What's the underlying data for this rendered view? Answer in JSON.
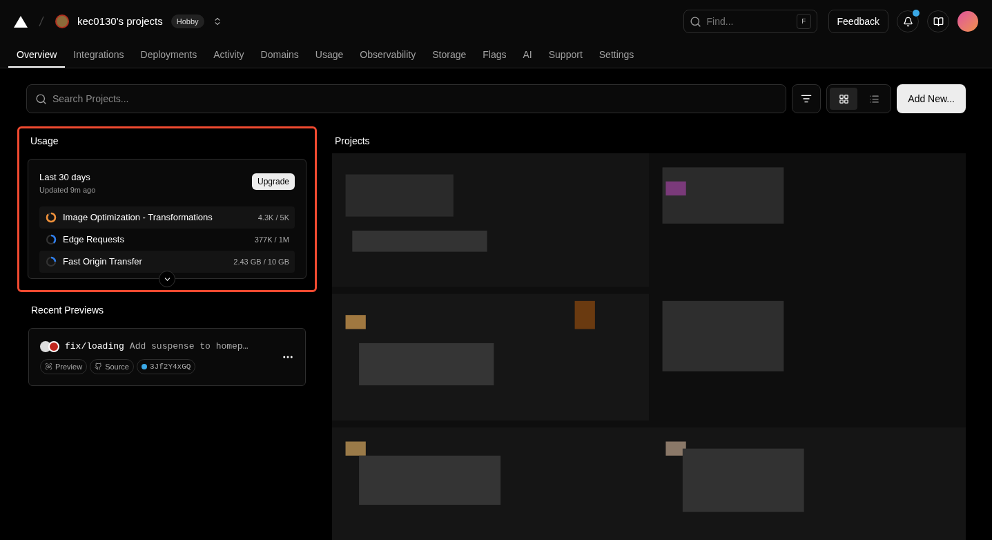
{
  "header": {
    "team": "kec0130's projects",
    "plan": "Hobby",
    "find": {
      "placeholder": "Find...",
      "shortcut": "F"
    },
    "feedback": "Feedback",
    "notification": true
  },
  "tabs": [
    {
      "label": "Overview",
      "selected": true
    },
    {
      "label": "Integrations",
      "selected": false
    },
    {
      "label": "Deployments",
      "selected": false
    },
    {
      "label": "Activity",
      "selected": false
    },
    {
      "label": "Domains",
      "selected": false
    },
    {
      "label": "Usage",
      "selected": false
    },
    {
      "label": "Observability",
      "selected": false
    },
    {
      "label": "Storage",
      "selected": false
    },
    {
      "label": "Flags",
      "selected": false
    },
    {
      "label": "AI",
      "selected": false
    },
    {
      "label": "Support",
      "selected": false
    },
    {
      "label": "Settings",
      "selected": false
    }
  ],
  "toolbar": {
    "search": {
      "placeholder": "Search Projects..."
    },
    "views": [
      {
        "kind": "grid",
        "selected": true
      },
      {
        "kind": "list",
        "selected": false
      }
    ],
    "add": "Add New..."
  },
  "usage": {
    "title": "Usage",
    "period": "Last 30 days",
    "updated": "Updated 9m ago",
    "upgrade": "Upgrade",
    "items": [
      {
        "name": "Image Optimization - Transformations",
        "reading": "4.3K / 5K",
        "color": "#f0913a"
      },
      {
        "name": "Edge Requests",
        "reading": "377K / 1M",
        "color": "#2f7ff0"
      },
      {
        "name": "Fast Origin Transfer",
        "reading": "2.43 GB / 10 GB",
        "color": "#2f7ff0"
      }
    ]
  },
  "previews": {
    "title": "Recent Previews",
    "items": [
      {
        "branch": "fix/loading",
        "message": "Add suspense to homep…",
        "tags": [
          {
            "kind": "preview",
            "label": "Preview"
          },
          {
            "kind": "source",
            "label": "Source"
          },
          {
            "kind": "commit",
            "label": "3Jf2Y4xGQ"
          }
        ]
      }
    ]
  },
  "projects": {
    "title": "Projects",
    "kind": "picture"
  }
}
